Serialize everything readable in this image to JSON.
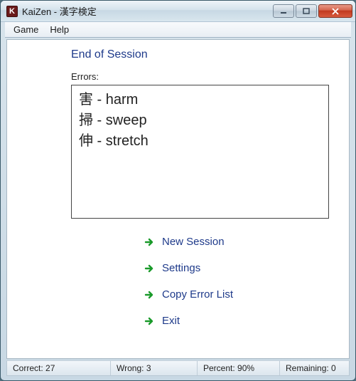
{
  "window": {
    "title": "KaiZen - 漢字検定",
    "icon_letter": "K"
  },
  "menu": {
    "game": "Game",
    "help": "Help"
  },
  "session": {
    "heading": "End of Session",
    "errors_label": "Errors:",
    "errors": [
      "害 - harm",
      "掃 - sweep",
      "伸 - stretch"
    ]
  },
  "actions": {
    "new_session": "New Session",
    "settings": "Settings",
    "copy_errors": "Copy Error List",
    "exit": "Exit"
  },
  "status": {
    "correct_label": "Correct:",
    "correct_value": "27",
    "wrong_label": "Wrong:",
    "wrong_value": "3",
    "percent_label": "Percent:",
    "percent_value": "90%",
    "remaining_label": "Remaining:",
    "remaining_value": "0"
  }
}
